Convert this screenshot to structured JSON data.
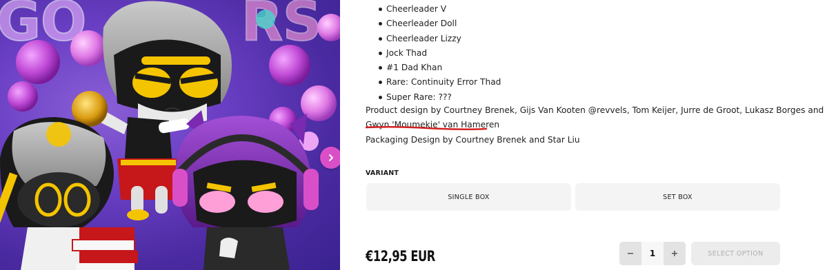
{
  "product": {
    "features": [
      "Cheerleader V",
      "Cheerleader Doll",
      "Cheerleader Lizzy",
      "Jock Thad",
      "#1 Dad Khan",
      "Rare: Continuity Error Thad",
      "Super Rare: ???"
    ],
    "credits": {
      "product_design_line1": "Product design by Courtney Brenek, Gijs Van Kooten @revvels, Tom Keijer, Jurre de Groot, Lukasz Borges and",
      "product_design_line2": "Gwyn 'Moumekie' van Hameren",
      "packaging_design": "Packaging Design by Courtney Brenek and Star Liu"
    },
    "banner_text": "GO ERS"
  },
  "variant": {
    "label": "VARIANT",
    "options": [
      "SINGLE BOX",
      "SET BOX"
    ]
  },
  "price": "€12,95 EUR",
  "quantity": {
    "value": "1",
    "minus": "−",
    "plus": "+"
  },
  "cta": {
    "select_option": "SELECT OPTION"
  },
  "colors": {
    "accent_arrow": "#d94fc8",
    "annotation_underline": "#d42020",
    "hero_bg": "#6a3fc4"
  },
  "icons": {
    "next": "chevron-right-icon"
  }
}
